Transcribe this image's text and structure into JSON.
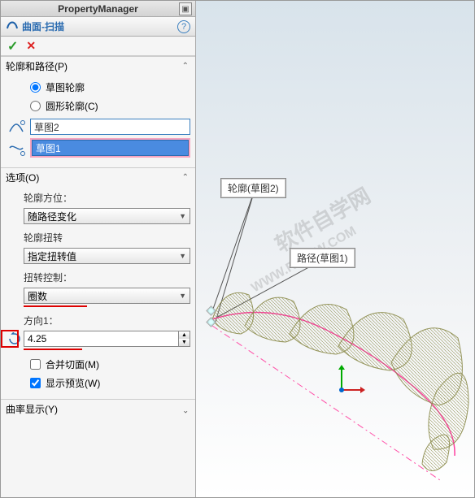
{
  "header": {
    "title": "PropertyManager"
  },
  "feature": {
    "title": "曲面-扫描"
  },
  "confirm": {
    "ok": "✓",
    "cancel": "✕"
  },
  "sections": {
    "profilePath": {
      "title": "轮廓和路径(P)",
      "radio1": "草图轮廓",
      "radio2": "圆形轮廓(C)",
      "profile_value": "草图2",
      "path_value": "草图1"
    },
    "options": {
      "title": "选项(O)",
      "orient_label": "轮廓方位：",
      "orient_value": "随路径变化",
      "twist_label": "轮廓扭转",
      "twist_type_value": "指定扭转值",
      "twist_ctrl_label": "扭转控制：",
      "twist_ctrl_value": "圈数",
      "dir_label": "方向1：",
      "dir_value": "4.25",
      "merge_label": "合并切面(M)",
      "preview_label": "显示预览(W)"
    },
    "curvature": {
      "title": "曲率显示(Y)"
    }
  },
  "callouts": {
    "profile": "轮廓(草图2)",
    "path": "路径(草图1)"
  },
  "watermarks": {
    "cn": "软件自学网",
    "en": "WWW.RJZXW.COM"
  },
  "icons": {
    "sweep": "∫",
    "help": "?",
    "pin": "▣",
    "chev_up": "⌃",
    "dd": "▼",
    "up": "▲",
    "dn": "▼",
    "reverse": "↻"
  }
}
